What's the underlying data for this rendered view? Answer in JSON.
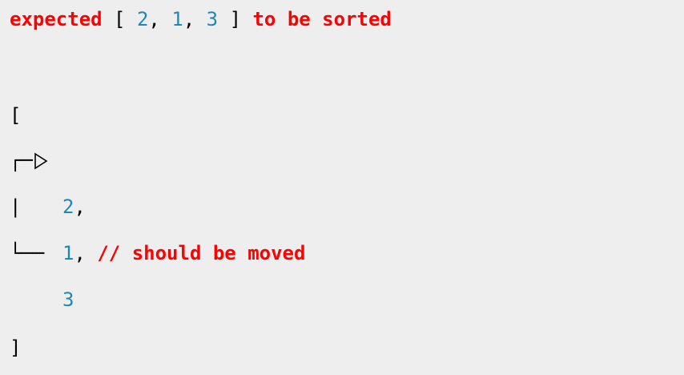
{
  "header": {
    "prefix": "expected",
    "open_bracket": "[",
    "values": [
      "2",
      "1",
      "3"
    ],
    "separator": ",",
    "close_bracket": "]",
    "suffix": "to be sorted"
  },
  "diff": {
    "open_bracket": "[",
    "arrow_top": "┌─",
    "vertical_bar": "|",
    "arrow_bottom": "└──",
    "items": [
      {
        "value": "2",
        "trail": ","
      },
      {
        "value": "1",
        "trail": ",",
        "comment": "// should be moved"
      },
      {
        "value": "3",
        "trail": ""
      }
    ],
    "close_bracket": "]"
  },
  "colors": {
    "background": "#eeeeee",
    "error": "#ff0000",
    "number": "#1f86b8",
    "text": "#000000"
  },
  "icons": {
    "move_pointer": "triangle-right-outline-icon"
  }
}
